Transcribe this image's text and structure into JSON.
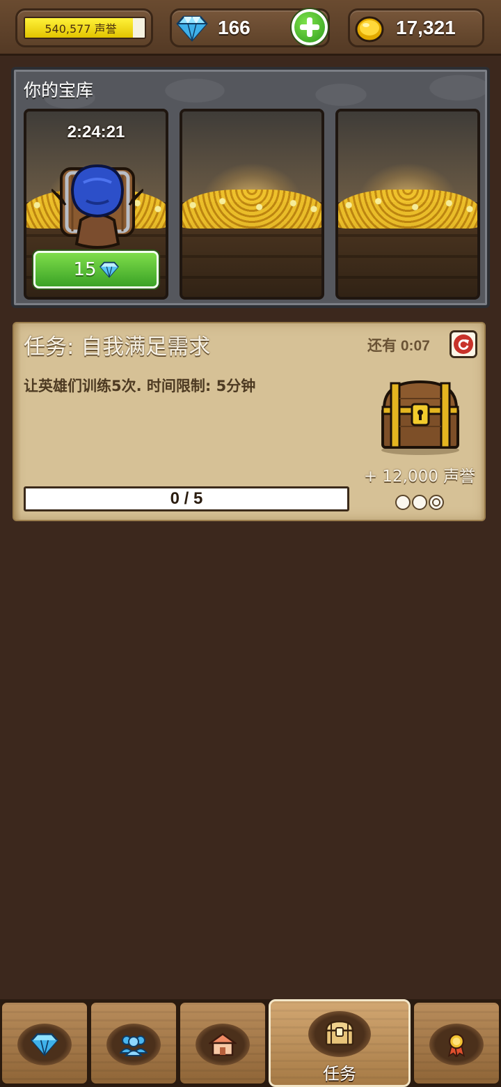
{
  "header": {
    "reputation": {
      "text": "540,577 声誉",
      "fill_fraction": 0.9
    },
    "gems": {
      "value": "166",
      "icon": "diamond-icon",
      "add_icon": "plus-icon"
    },
    "gold": {
      "value": "17,321",
      "icon": "gold-coin-icon"
    }
  },
  "vault": {
    "title": "你的宝库",
    "slots": [
      {
        "timer": "2:24:21",
        "contents": "hero-chest",
        "unlock_cost": "15",
        "cost_icon": "diamond-icon"
      },
      {
        "contents": "empty"
      },
      {
        "contents": "empty"
      }
    ]
  },
  "quest": {
    "title": "任务: 自我满足需求",
    "time_left": "还有 0:07",
    "refresh_icon": "refresh-icon",
    "description": "让英雄们训练5次. 时间限制: 5分钟",
    "reward_icon": "treasure-chest-icon",
    "reward": "+ 12,000 声誉",
    "progress": {
      "text": "0 / 5",
      "current": 0,
      "total": 5
    },
    "stars": {
      "total": 3,
      "marked": 1
    }
  },
  "bottom_nav": {
    "tabs": [
      {
        "icon": "diamond-icon",
        "label": ""
      },
      {
        "icon": "heroes-icon",
        "label": ""
      },
      {
        "icon": "buildings-icon",
        "label": ""
      },
      {
        "icon": "chest-icon",
        "label": "任务",
        "active": true
      },
      {
        "icon": "medal-icon",
        "label": ""
      }
    ]
  },
  "colors": {
    "background": "#3c281d",
    "accent_green": "#3aa226",
    "parchment": "#d6c196",
    "reputation_bar": "#f2d800"
  }
}
